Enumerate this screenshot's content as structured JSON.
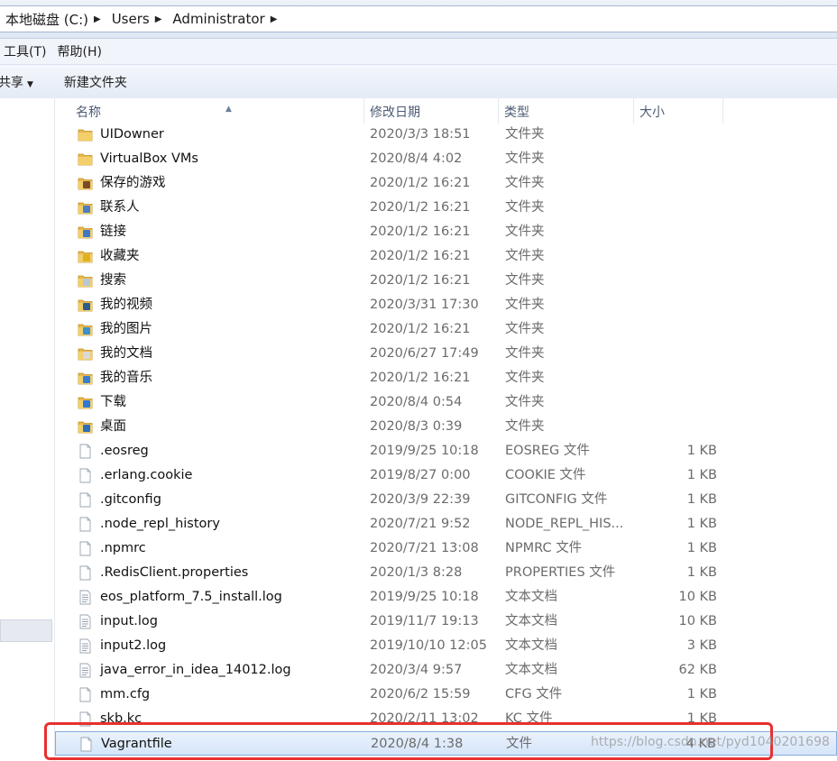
{
  "address": {
    "crumbs": [
      "本地磁盘 (C:)",
      "Users",
      "Administrator"
    ]
  },
  "menu": {
    "items": [
      "工具(T)",
      "帮助(H)"
    ]
  },
  "toolbar": {
    "share_label": "共享",
    "new_folder_label": "新建文件夹"
  },
  "columns": {
    "name": "名称",
    "date": "修改日期",
    "type": "类型",
    "size": "大小"
  },
  "files": [
    {
      "name": "UIDowner",
      "date": "2020/3/3 18:51",
      "type": "文件夹",
      "size": "",
      "icon": "folder-icon"
    },
    {
      "name": "VirtualBox VMs",
      "date": "2020/8/4 4:02",
      "type": "文件夹",
      "size": "",
      "icon": "folder-icon"
    },
    {
      "name": "保存的游戏",
      "date": "2020/1/2 16:21",
      "type": "文件夹",
      "size": "",
      "icon": "saved-games-folder-icon"
    },
    {
      "name": "联系人",
      "date": "2020/1/2 16:21",
      "type": "文件夹",
      "size": "",
      "icon": "contacts-folder-icon"
    },
    {
      "name": "链接",
      "date": "2020/1/2 16:21",
      "type": "文件夹",
      "size": "",
      "icon": "links-folder-icon"
    },
    {
      "name": "收藏夹",
      "date": "2020/1/2 16:21",
      "type": "文件夹",
      "size": "",
      "icon": "favorites-folder-icon"
    },
    {
      "name": "搜索",
      "date": "2020/1/2 16:21",
      "type": "文件夹",
      "size": "",
      "icon": "searches-folder-icon"
    },
    {
      "name": "我的视频",
      "date": "2020/3/31 17:30",
      "type": "文件夹",
      "size": "",
      "icon": "videos-folder-icon"
    },
    {
      "name": "我的图片",
      "date": "2020/1/2 16:21",
      "type": "文件夹",
      "size": "",
      "icon": "pictures-folder-icon"
    },
    {
      "name": "我的文档",
      "date": "2020/6/27 17:49",
      "type": "文件夹",
      "size": "",
      "icon": "documents-folder-icon"
    },
    {
      "name": "我的音乐",
      "date": "2020/1/2 16:21",
      "type": "文件夹",
      "size": "",
      "icon": "music-folder-icon"
    },
    {
      "name": "下载",
      "date": "2020/8/4 0:54",
      "type": "文件夹",
      "size": "",
      "icon": "downloads-folder-icon"
    },
    {
      "name": "桌面",
      "date": "2020/8/3 0:39",
      "type": "文件夹",
      "size": "",
      "icon": "desktop-folder-icon"
    },
    {
      "name": ".eosreg",
      "date": "2019/9/25 10:18",
      "type": "EOSREG 文件",
      "size": "1 KB",
      "icon": "file-icon"
    },
    {
      "name": ".erlang.cookie",
      "date": "2019/8/27 0:00",
      "type": "COOKIE 文件",
      "size": "1 KB",
      "icon": "file-icon"
    },
    {
      "name": ".gitconfig",
      "date": "2020/3/9 22:39",
      "type": "GITCONFIG 文件",
      "size": "1 KB",
      "icon": "file-icon"
    },
    {
      "name": ".node_repl_history",
      "date": "2020/7/21 9:52",
      "type": "NODE_REPL_HIS...",
      "size": "1 KB",
      "icon": "file-icon"
    },
    {
      "name": ".npmrc",
      "date": "2020/7/21 13:08",
      "type": "NPMRC 文件",
      "size": "1 KB",
      "icon": "file-icon"
    },
    {
      "name": ".RedisClient.properties",
      "date": "2020/1/3 8:28",
      "type": "PROPERTIES 文件",
      "size": "1 KB",
      "icon": "file-icon"
    },
    {
      "name": "eos_platform_7.5_install.log",
      "date": "2019/9/25 10:18",
      "type": "文本文档",
      "size": "10 KB",
      "icon": "text-file-icon"
    },
    {
      "name": "input.log",
      "date": "2019/11/7 19:13",
      "type": "文本文档",
      "size": "10 KB",
      "icon": "text-file-icon"
    },
    {
      "name": "input2.log",
      "date": "2019/10/10 12:05",
      "type": "文本文档",
      "size": "3 KB",
      "icon": "text-file-icon"
    },
    {
      "name": "java_error_in_idea_14012.log",
      "date": "2020/3/4 9:57",
      "type": "文本文档",
      "size": "62 KB",
      "icon": "text-file-icon"
    },
    {
      "name": "mm.cfg",
      "date": "2020/6/2 15:59",
      "type": "CFG 文件",
      "size": "1 KB",
      "icon": "file-icon"
    },
    {
      "name": "skb.kc",
      "date": "2020/2/11 13:02",
      "type": "KC 文件",
      "size": "1 KB",
      "icon": "file-icon"
    },
    {
      "name": "Vagrantfile",
      "date": "2020/8/4 1:38",
      "type": "文件",
      "size": "4 KB",
      "icon": "file-icon",
      "selected": true
    }
  ],
  "watermark": "https://blog.csdn.net/pyd1040201698",
  "colors": {
    "folder": "#e8b84a",
    "selection_border": "#84acdd",
    "highlight_box": "#e8302f"
  }
}
